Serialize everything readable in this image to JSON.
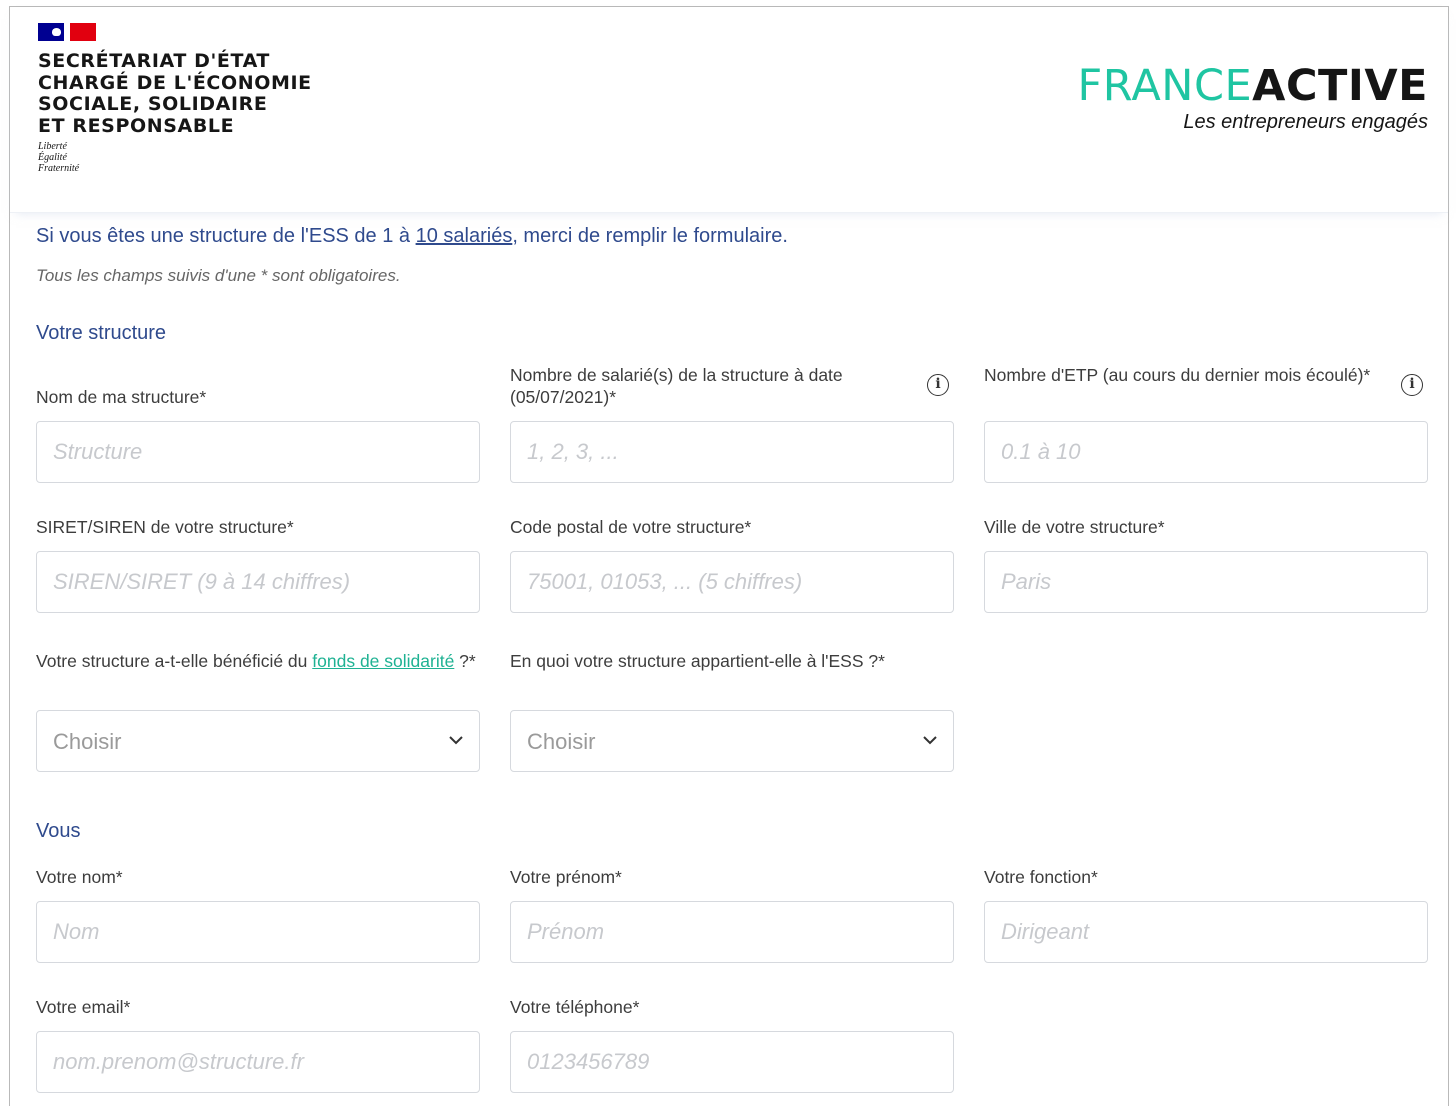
{
  "header": {
    "gov_title_lines": [
      "SECRÉTARIAT D'ÉTAT",
      "CHARGÉ DE L'ÉCONOMIE",
      "SOCIALE, SOLIDAIRE",
      "ET RESPONSABLE"
    ],
    "gov_motto": [
      "Liberté",
      "Égalité",
      "Fraternité"
    ],
    "brand_part1": "FRANCE",
    "brand_part2": "ACTIVE",
    "brand_tagline": "Les entrepreneurs engagés",
    "colors": {
      "brand_green": "#1fc5a2",
      "gov_blue": "#000091",
      "gov_red": "#e1000f"
    }
  },
  "intro": {
    "before_link": "Si vous êtes une structure de l'ESS de 1 à ",
    "link": "10 salariés",
    "after_link": ", merci de remplir le formulaire.",
    "required_note": "Tous les champs suivis d'une * sont obligatoires."
  },
  "structure": {
    "title": "Votre structure",
    "name": {
      "label": "Nom de ma structure*",
      "placeholder": "Structure"
    },
    "employees": {
      "label": "Nombre de salarié(s) de la structure à date (05/07/2021)*",
      "placeholder": "1, 2, 3, ..."
    },
    "etp": {
      "label": "Nombre d'ETP (au cours du dernier mois écoulé)*",
      "placeholder": "0.1 à 10"
    },
    "siret": {
      "label": "SIRET/SIREN de votre structure*",
      "placeholder": "SIREN/SIRET (9 à 14 chiffres)"
    },
    "postal": {
      "label": "Code postal de votre structure*",
      "placeholder": "75001, 01053, ... (5 chiffres)"
    },
    "city": {
      "label": "Ville de votre structure*",
      "placeholder": "Paris"
    },
    "fund": {
      "label_before": "Votre structure a-t-elle bénéficié du ",
      "label_link": "fonds de solidarité",
      "label_after": " ?*",
      "value": "Choisir"
    },
    "ess": {
      "label": "En quoi votre structure appartient-elle à l'ESS ?*",
      "value": "Choisir"
    }
  },
  "person": {
    "title": "Vous",
    "lastname": {
      "label": "Votre nom*",
      "placeholder": "Nom"
    },
    "firstname": {
      "label": "Votre prénom*",
      "placeholder": "Prénom"
    },
    "role": {
      "label": "Votre fonction*",
      "placeholder": "Dirigeant"
    },
    "email": {
      "label": "Votre email*",
      "placeholder": "nom.prenom@structure.fr"
    },
    "phone": {
      "label": "Votre téléphone*",
      "placeholder": "0123456789"
    }
  }
}
